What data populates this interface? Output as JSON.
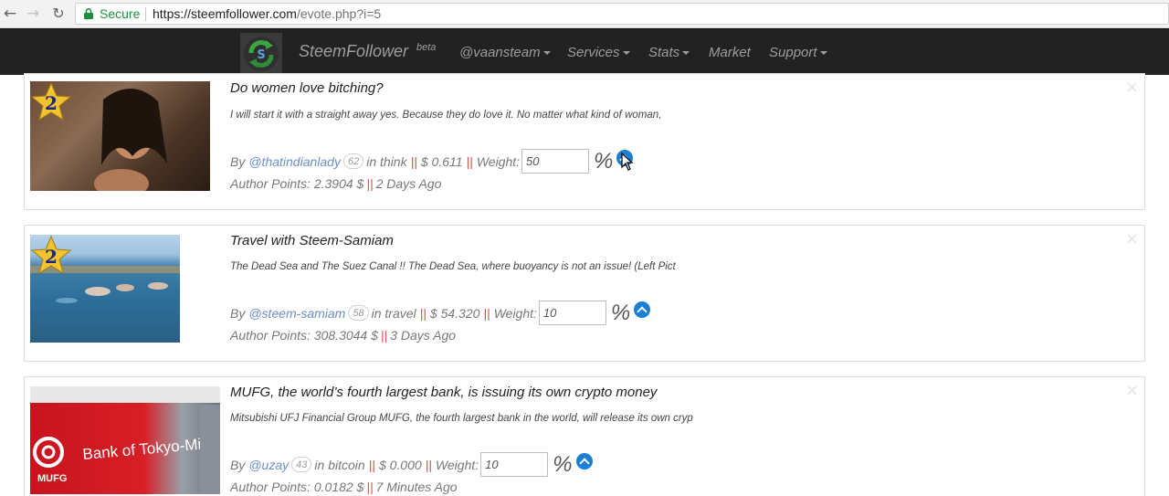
{
  "browser": {
    "secure_label": "Secure",
    "url_domain": "https://steemfollower.com",
    "url_path": "/evote.php?i=5"
  },
  "navbar": {
    "brand": "SteemFollower",
    "brand_sup": "beta",
    "items": [
      {
        "label": "@vaansteam",
        "dropdown": true
      },
      {
        "label": "Services",
        "dropdown": true
      },
      {
        "label": "Stats",
        "dropdown": true
      },
      {
        "label": "Market",
        "dropdown": false
      },
      {
        "label": "Support",
        "dropdown": true
      }
    ]
  },
  "posts": [
    {
      "rank_badge": "2",
      "thumb_icon": "portrait-photo",
      "title": "Do women love bitching?",
      "excerpt": "I will start it with a straight away yes. Because they do love it. No matter what kind of woman,",
      "by": "By",
      "author": "@thatindianlady",
      "reputation": "62",
      "in_label": "in",
      "category": "think",
      "separator": "||",
      "payout": "$ 0.611",
      "weight_label": "Weight:",
      "weight_value": "50",
      "percent": "%",
      "author_points_label": "Author Points:",
      "author_points": "2.3904 $",
      "age": "2 Days Ago"
    },
    {
      "rank_badge": "2",
      "thumb_icon": "sea-swimmers-photo",
      "title": "Travel with Steem-Samiam",
      "excerpt": "The Dead Sea and The Suez Canal !! The Dead Sea, where buoyancy is not an issue! (Left Pict",
      "by": "By",
      "author": "@steem-samiam",
      "reputation": "58",
      "in_label": "in",
      "category": "travel",
      "separator": "||",
      "payout": "$ 54.320",
      "weight_label": "Weight:",
      "weight_value": "10",
      "percent": "%",
      "author_points_label": "Author Points:",
      "author_points": "308.3044 $",
      "age": "3 Days Ago"
    },
    {
      "thumb_icon": "bank-building-photo",
      "thumb_text": "Bank of Tokyo-Mitsubishi UFJ",
      "thumb_logo_text": "MUFG",
      "title": "MUFG, the world’s fourth largest bank, is issuing its own crypto money",
      "excerpt": "Mitsubishi UFJ Financial Group MUFG, the fourth largest bank in the world, will release its own cryp",
      "by": "By",
      "author": "@uzay",
      "reputation": "43",
      "in_label": "in",
      "category": "bitcoin",
      "separator": "||",
      "payout": "$ 0.000",
      "weight_label": "Weight:",
      "weight_value": "10",
      "percent": "%",
      "author_points_label": "Author Points:",
      "author_points": "0.0182 $",
      "age": "7 Minutes Ago"
    }
  ],
  "colors": {
    "navbar_bg": "#222222",
    "navbar_text": "#9d9d9d",
    "author_link": "#6a8ec7",
    "separator": "#d9534f",
    "vote_button": "#1a7fd4",
    "secure_green": "#1e8e3e"
  }
}
